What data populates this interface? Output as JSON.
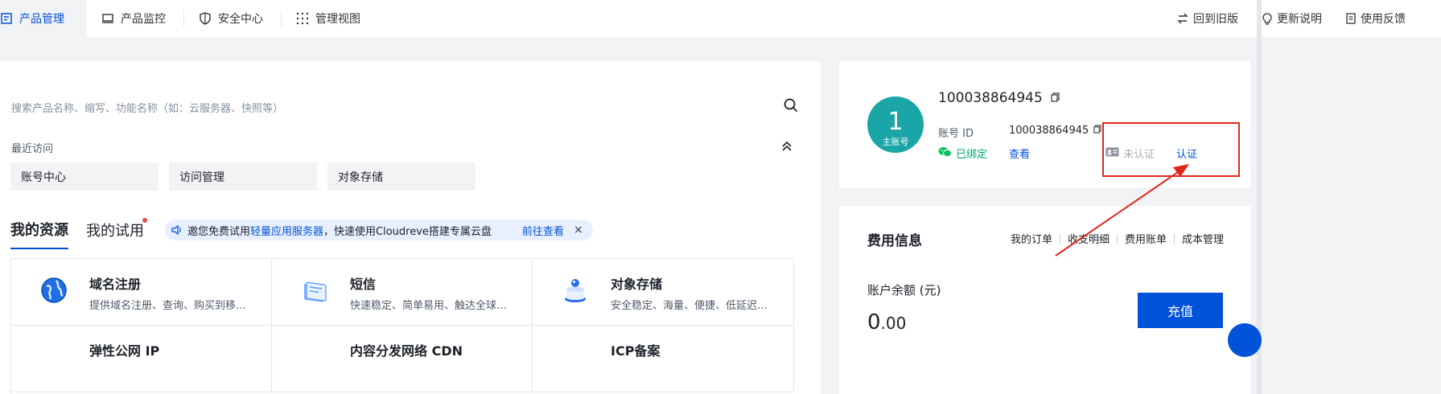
{
  "topbar": {
    "tabs": [
      {
        "label": "产品管理",
        "icon": "product-manage-icon",
        "active": true
      },
      {
        "label": "产品监控",
        "icon": "monitor-icon"
      },
      {
        "label": "安全中心",
        "icon": "shield-icon"
      },
      {
        "label": "管理视图",
        "icon": "grid-icon"
      }
    ],
    "right": [
      {
        "label": "回到旧版",
        "icon": "switch-icon"
      },
      {
        "label": "更新说明",
        "icon": "bulb-icon"
      },
      {
        "label": "使用反馈",
        "icon": "feedback-icon"
      }
    ]
  },
  "search": {
    "placeholder": "搜索产品名称、缩写、功能名称（如：云服务器、快照等）"
  },
  "recent": {
    "label": "最近访问",
    "items": [
      "账号中心",
      "访问管理",
      "对象存储"
    ]
  },
  "resources": {
    "tabs": [
      "我的资源",
      "我的试用"
    ],
    "promo": {
      "prefix": "邀您免费试用",
      "highlight": "轻量应用服务器",
      "suffix": "，快速使用Cloudreve搭建专属云盘",
      "link": "前往查看",
      "close": "×"
    },
    "products": [
      {
        "title": "域名注册",
        "desc": "提供域名注册、查询、购买到移…",
        "icon": "globe-icon"
      },
      {
        "title": "短信",
        "desc": "快速稳定、简单易用、触达全球…",
        "icon": "sms-icon"
      },
      {
        "title": "对象存储",
        "desc": "安全稳定、海量、便捷、低延迟…",
        "icon": "storage-icon"
      },
      {
        "title": "弹性公网 IP",
        "desc": "",
        "icon": "eip-icon"
      },
      {
        "title": "内容分发网络 CDN",
        "desc": "",
        "icon": "cdn-icon"
      },
      {
        "title": "ICP备案",
        "desc": "",
        "icon": "icp-icon"
      }
    ]
  },
  "account": {
    "avatar_num": "1",
    "avatar_role": "主账号",
    "name": "100038864945",
    "id_label": "账号 ID",
    "id_value": "100038864945",
    "wechat": "已绑定",
    "view": "查看",
    "unverified": "未认证",
    "verify": "认证"
  },
  "fees": {
    "title": "费用信息",
    "links": [
      "我的订单",
      "收支明细",
      "费用账单",
      "成本管理"
    ],
    "balance_label": "账户余额 (元)",
    "balance_int": "0",
    "balance_dec": ".00",
    "recharge": "充值"
  },
  "colors": {
    "accent": "#0052d9",
    "success": "#00a870",
    "annotation": "#e0271b"
  }
}
